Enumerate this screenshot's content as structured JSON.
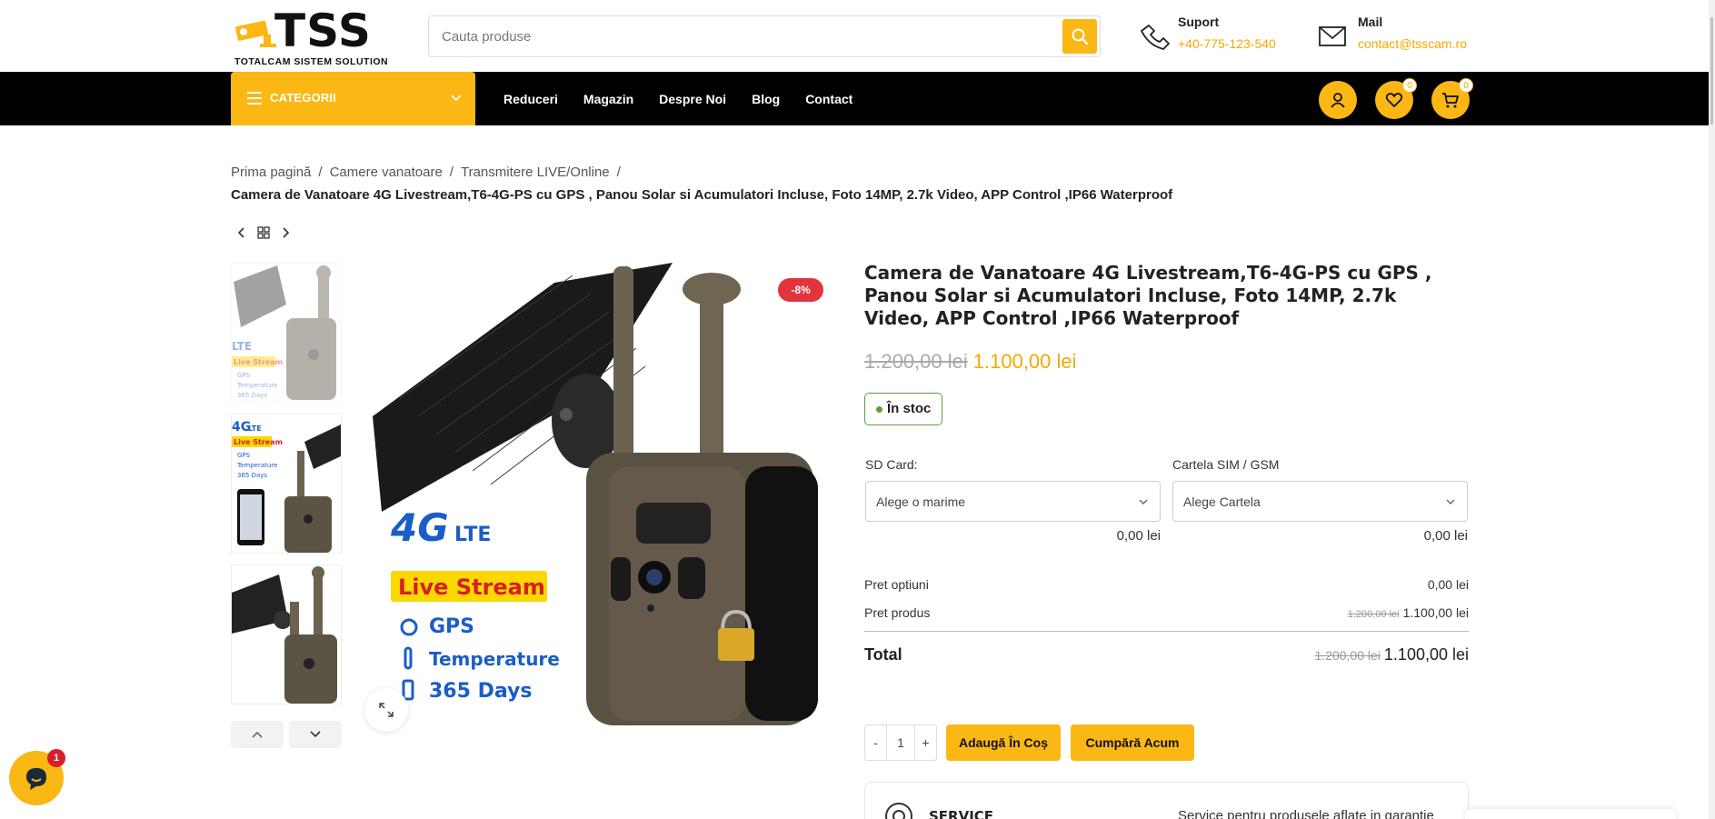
{
  "header": {
    "logo_text": "TSS",
    "logo_subtitle": "TOTALCAM SISTEM SOLUTION",
    "search_placeholder": "Cauta produse",
    "support": {
      "title": "Suport",
      "value": "+40-775-123-540"
    },
    "mail": {
      "title": "Mail",
      "value": "contact@tsscam.ro"
    }
  },
  "nav": {
    "categories_label": "CATEGORII",
    "links": [
      "Reduceri",
      "Magazin",
      "Despre Noi",
      "Blog",
      "Contact"
    ],
    "wishlist_count": "0",
    "cart_count": "0"
  },
  "breadcrumb": {
    "items": [
      "Prima pagină",
      "Camere vanatoare",
      "Transmitere LIVE/Online"
    ],
    "current": "Camera de Vanatoare 4G Livestream,T6-4G-PS cu GPS , Panou Solar si Acumulatori Incluse, Foto 14MP, 2.7k Video, APP Control ,IP66 Waterproof"
  },
  "product": {
    "title": "Camera de Vanatoare 4G Livestream,T6-4G-PS cu GPS , Panou Solar si Acumulatori Incluse, Foto 14MP, 2.7k Video, APP Control ,IP66 Waterproof",
    "discount": "-8%",
    "price_old": "1.200,00 lei",
    "price_new": "1.100,00 lei",
    "stock": "În stoc",
    "image_text": {
      "lte": "4G",
      "lte_suffix": "LTE",
      "live": "Live Stream",
      "gps": "GPS",
      "temperature": "Temperature",
      "days": "365 Days"
    },
    "thumb1_text": [
      "LTE",
      "Live Stream",
      "GPS",
      "Temperature",
      "365 Days"
    ],
    "thumb2_text": [
      "4G",
      "LTE",
      "Live Stream",
      "GPS",
      "Temperature",
      "365 Days"
    ],
    "options": [
      {
        "label": "SD Card:",
        "value": "Alege o marime",
        "price": "0,00 lei"
      },
      {
        "label": "Cartela SIM / GSM",
        "value": "Alege Cartela",
        "price": "0,00 lei"
      }
    ],
    "summary": {
      "options_label": "Pret optiuni",
      "options_value": "0,00 lei",
      "product_label": "Pret produs",
      "product_old": "1.200,00 lei",
      "product_new": "1.100,00 lei",
      "total_label": "Total",
      "total_old": "1.200,00 lei",
      "total_new": "1.100,00 lei"
    },
    "quantity": "1",
    "qty_minus": "-",
    "qty_plus": "+",
    "add_to_cart": "Adaugă În Coș",
    "buy_now": "Cumpără Acum"
  },
  "service": {
    "title": "SERVICE",
    "desc": "Service pentru produsele aflate in garantie"
  },
  "chat": {
    "badge": "1"
  },
  "colors": {
    "accent": "#fbb714",
    "price": "#f5a800",
    "badge": "#e2343c",
    "stock": "#5b9f3c"
  }
}
